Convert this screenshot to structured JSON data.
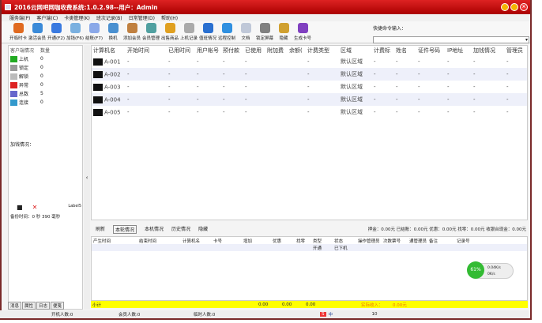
{
  "window": {
    "title": "2016云网吧网咖收费系统:1.0.2.98--用户：Admin"
  },
  "menu": [
    "服务端(P)",
    "客户端(C)",
    "卡类管理(K)",
    "班次记录(B)",
    "日常管理(D)",
    "帮助(H)"
  ],
  "toolbar": [
    {
      "label": "开临时卡",
      "color": "#e06a20"
    },
    {
      "label": "激活会员",
      "color": "#3a8ad8"
    },
    {
      "label": "开通(F2)",
      "color": "#3a7ae0"
    },
    {
      "label": "加钱(F6)",
      "color": "#7ab0e0"
    },
    {
      "label": "结账(F7)",
      "color": "#8aa8e8"
    },
    {
      "label": "换机",
      "color": "#4a90d0"
    },
    {
      "label": "添加会员",
      "color": "#c08040"
    },
    {
      "label": "会员管理",
      "color": "#50a0a0"
    },
    {
      "label": "出售商品",
      "color": "#e0a020"
    },
    {
      "label": "上机记录",
      "color": "#aaaaaa"
    },
    {
      "label": "值班情况",
      "color": "#2a70d0"
    },
    {
      "label": "远程控制",
      "color": "#3090e0"
    },
    {
      "label": "文档",
      "color": "#c0c8d8"
    },
    {
      "label": "锁定屏幕",
      "color": "#808080"
    },
    {
      "label": "隐藏",
      "color": "#d0a030"
    },
    {
      "label": "生成卡号",
      "color": "#8040c0"
    }
  ],
  "quick": {
    "label": "快捷命令输入：",
    "value": ""
  },
  "left": {
    "headers": [
      "客户端情况",
      "数量"
    ],
    "items": [
      {
        "label": "上机",
        "count": "0",
        "color": "#2a2"
      },
      {
        "label": "锁定",
        "count": "0",
        "color": "#999"
      },
      {
        "label": "解锁",
        "count": "0",
        "color": "#bbb"
      },
      {
        "label": "异常",
        "count": "0",
        "color": "#d22"
      },
      {
        "label": "总数",
        "count": "5",
        "color": "#66c"
      },
      {
        "label": "连接",
        "count": "0",
        "color": "#39c"
      }
    ],
    "addmoney_label": "加钱情况：",
    "label5": "Label5",
    "backup_time": "备份时间：0 秒 390 毫秒",
    "tabs": [
      "消息",
      "属性",
      "日志",
      "便笺"
    ]
  },
  "grid": {
    "headers": [
      "计算机名",
      "开始时间",
      "已用时间",
      "用户帐号",
      "预付款",
      "已使用",
      "附加费",
      "余额(",
      "计费类型",
      "区域",
      "计费标",
      "姓名",
      "证件号码",
      "IP地址",
      "加钱情况",
      "管理员"
    ],
    "rows": [
      [
        "A-001",
        "-",
        "-",
        "-",
        "-",
        "-",
        "",
        "",
        "-",
        "默认区域",
        "-",
        "-",
        "-",
        "-",
        "-",
        "-"
      ],
      [
        "A-002",
        "-",
        "-",
        "-",
        "-",
        "-",
        "",
        "",
        "-",
        "默认区域",
        "-",
        "-",
        "-",
        "-",
        "-",
        "-"
      ],
      [
        "A-003",
        "-",
        "-",
        "-",
        "-",
        "-",
        "",
        "",
        "-",
        "默认区域",
        "-",
        "-",
        "-",
        "-",
        "-",
        "-"
      ],
      [
        "A-004",
        "-",
        "-",
        "-",
        "-",
        "-",
        "",
        "",
        "-",
        "默认区域",
        "-",
        "-",
        "-",
        "-",
        "-",
        "-"
      ],
      [
        "A-005",
        "-",
        "-",
        "-",
        "-",
        "-",
        "",
        "",
        "-",
        "默认区域",
        "-",
        "-",
        "-",
        "-",
        "-",
        "-"
      ]
    ]
  },
  "bottom": {
    "tabs": [
      "刷新",
      "本轮情况",
      "本机情况",
      "历史情况",
      "隐藏"
    ],
    "stats": "押金：0.00元 已结账：0.00元 优惠：0.00元 找零：0.00元 收银台现金：0.00元",
    "headers": [
      "产生时间",
      "结束时间",
      "计算机名",
      "卡号",
      "增加",
      "优惠",
      "找零",
      "类型",
      "状态",
      "操作管理员",
      "次数票号",
      "通管理员",
      "备注",
      "记录号"
    ],
    "row": [
      "",
      "",
      "",
      "",
      "",
      "",
      "",
      "开通",
      "已下机",
      "",
      "",
      "",
      "",
      ""
    ],
    "subtotal": {
      "label": "小计",
      "v1": "0.00",
      "v2": "0.00",
      "v3": "0.00",
      "income_label": "实际收入：",
      "income": "0.00元"
    }
  },
  "net": {
    "percent": "61%",
    "up": "0.04K/s",
    "down": "0K/s"
  },
  "status": {
    "online": "开机人数:0",
    "member": "会员人数:0",
    "temp": "临时人数:0",
    "ime": "中",
    "num": "10"
  }
}
